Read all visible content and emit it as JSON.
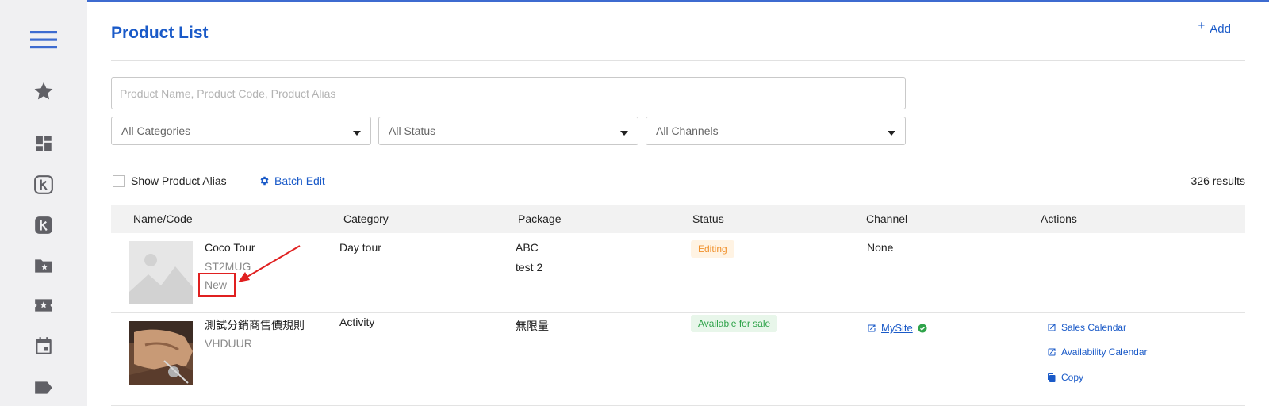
{
  "header": {
    "title": "Product List",
    "add_label": "Add"
  },
  "search": {
    "placeholder": "Product Name, Product Code, Product Alias"
  },
  "filters": {
    "category": "All Categories",
    "status": "All Status",
    "channel": "All Channels"
  },
  "toolbar": {
    "show_alias_label": "Show Product Alias",
    "batch_edit_label": "Batch Edit",
    "results": "326 results"
  },
  "table": {
    "columns": [
      "Name/Code",
      "Category",
      "Package",
      "Status",
      "Channel",
      "Actions"
    ],
    "rows": [
      {
        "name": "Coco Tour",
        "code": "ST2MUG",
        "tag": "New",
        "category": "Day tour",
        "packages": [
          "ABC",
          "test 2"
        ],
        "status": "Editing",
        "channel": "None"
      },
      {
        "name": "測試分銷商售價規則",
        "code": "VHDUUR",
        "category": "Activity",
        "packages": [
          "無限量"
        ],
        "status": "Available for sale",
        "channel": "MySite",
        "actions": [
          "Sales Calendar",
          "Availability Calendar",
          "Copy"
        ]
      }
    ]
  },
  "colors": {
    "accent": "#1a5ac8",
    "annotation": "#e02020",
    "editing": "#f0912d",
    "available": "#2fa34a"
  },
  "icons": [
    "menu-icon",
    "star-icon",
    "dashboard-icon",
    "k-outline-icon",
    "k-filled-icon",
    "folder-star-icon",
    "ticket-star-icon",
    "calendar-icon",
    "label-icon",
    "gear-icon",
    "external-link-icon",
    "check-circle-icon",
    "copy-icon",
    "image-placeholder-icon"
  ]
}
